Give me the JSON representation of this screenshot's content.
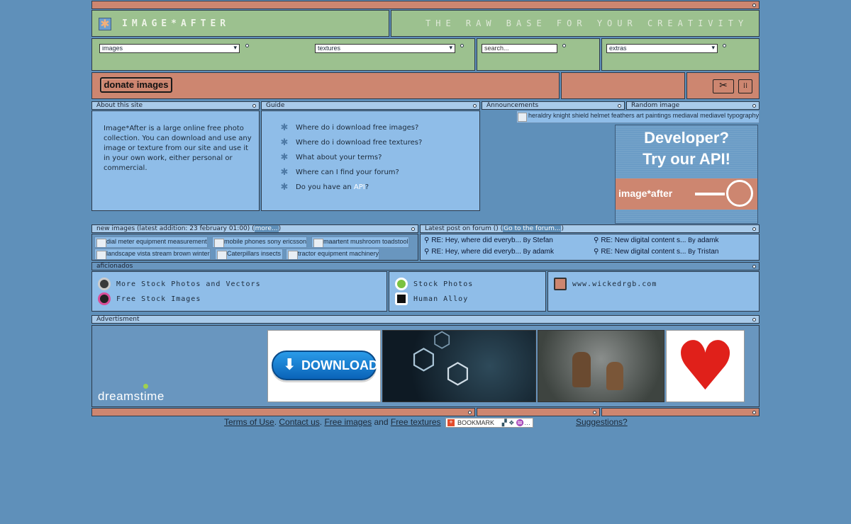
{
  "header": {
    "logo_text": "IMAGE*AFTER",
    "tagline": "THE RAW BASE FOR YOUR CREATIVITY"
  },
  "search": {
    "category_value": "images",
    "subcategory_value": "textures",
    "search_placeholder": "search...",
    "extras_value": "extras"
  },
  "toolbar": {
    "donate_label": "donate images"
  },
  "panels": {
    "about_title": "About this site",
    "about_text": "Image*After is a large online free photo collection. You can download and use any image or texture from our site and use it in your own work, either personal or commercial.",
    "guide_title": "Guide",
    "guide_items": [
      "Where do i download free images?",
      "Where do i download free textures?",
      "What about your terms?",
      "Where can I find your forum?",
      "Do you have an"
    ],
    "guide_api_link": "API",
    "guide_api_suffix": "?",
    "announcements_title": "Announcements",
    "random_title": "Random image",
    "random_image_alt": "heraldry knight shield helmet feathers art paintings mediaval mediavel typography",
    "api_ad_line1": "Developer?",
    "api_ad_line2": "Try our API!",
    "api_ad_brand": "image*after"
  },
  "new_images": {
    "title": "new images (latest addition: 23 february 01:00) (",
    "more_link": "more...",
    "title_end": ")",
    "thumbs": [
      "dial meter equipment measurement",
      "mobile phones sony ericsson",
      "maartent mushroom toadstool",
      "landscape vista stream brown winter",
      "Caterpillars insects",
      "tractor equipment machinery"
    ]
  },
  "forum": {
    "title": "Latest post on forum () (",
    "go_link": "Go to the forum...",
    "title_end": ")",
    "posts": [
      {
        "subject": "RE: Hey, where did everyb...",
        "by": "By",
        "author": "Stefan"
      },
      {
        "subject": "RE: New digital content s...",
        "by": "By",
        "author": "adamk"
      },
      {
        "subject": "RE: Hey, where did everyb...",
        "by": "By",
        "author": "adamk"
      },
      {
        "subject": "RE: New digital content s...",
        "by": "By",
        "author": "Tristan"
      }
    ]
  },
  "aficionados": {
    "title": "aficionados",
    "links": [
      "More Stock Photos and Vectors",
      "Free Stock Images",
      "Stock Photos",
      "Human Alloy",
      "www.wickedrgb.com"
    ]
  },
  "advertisment": {
    "title": "Advertisment",
    "brand": "dreamstime",
    "download_label": "DOWNLOAD"
  },
  "footer": {
    "terms": "Terms of Use",
    "sep1": ".",
    "contact": "Contact us",
    "sep2": ".",
    "free_images": "Free images",
    "and": "and",
    "free_textures": "Free textures",
    "bookmark": "BOOKMARK",
    "suggestions": "Suggestions?"
  },
  "colors": {
    "background": "#5f90ba",
    "salmon": "#cd8670",
    "green": "#9cc18f",
    "light_blue": "#8fbde8"
  }
}
